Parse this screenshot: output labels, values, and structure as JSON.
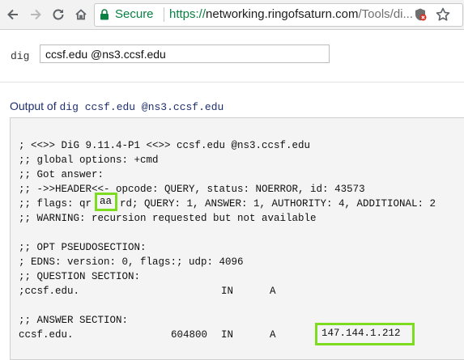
{
  "browser": {
    "secure_label": "Secure",
    "url_scheme": "https://",
    "url_host": "networking.ringofsaturn.com",
    "url_path": "/Tools/di..."
  },
  "form": {
    "dig_label": "dig",
    "query_value": "ccsf.edu @ns3.ccsf.edu"
  },
  "output": {
    "heading_prefix": "Output of",
    "heading_command": "dig ccsf.edu @ns3.ccsf.edu",
    "lines": {
      "l1": "; <<>> DiG 9.11.4-P1 <<>> ccsf.edu @ns3.ccsf.edu",
      "l2": ";; global options: +cmd",
      "l3": ";; Got answer:",
      "l4": ";; ->>HEADER<<- opcode: QUERY, status: NOERROR, id: 43573",
      "l5_pre": ";; flags: qr",
      "l5_flag": "aa",
      "l5_post": "rd; QUERY: 1, ANSWER: 1, AUTHORITY: 4, ADDITIONAL: 2",
      "l6": ";; WARNING: recursion requested but not available",
      "l7": ";; OPT PSEUDOSECTION:",
      "l8": "; EDNS: version: 0, flags:; udp: 4096",
      "l9": ";; QUESTION SECTION:",
      "l10_name": ";ccsf.edu.",
      "l10_class": "IN",
      "l10_type": "A",
      "l11": ";; ANSWER SECTION:",
      "l12_name": "ccsf.edu.",
      "l12_ttl": "604800",
      "l12_class": "IN",
      "l12_type": "A",
      "l12_ip": "147.144.1.212"
    }
  },
  "colors": {
    "highlight": "#7ddc1f",
    "secure_green": "#0b8043",
    "heading_blue": "#1f2f6d"
  }
}
